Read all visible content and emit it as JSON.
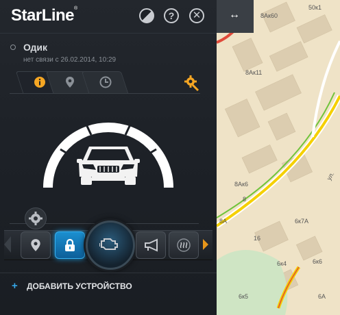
{
  "app": {
    "logo": "StarLine",
    "logo_mark": "®"
  },
  "toolbar": {
    "help_glyph": "?",
    "close_glyph": "✕"
  },
  "device": {
    "name": "Одик",
    "status": "нет связи с 26.02.2014, 10:29"
  },
  "tabs": [
    {
      "icon": "info-icon",
      "active": true
    },
    {
      "icon": "location-pin-icon",
      "active": false
    },
    {
      "icon": "clock-icon",
      "active": false
    }
  ],
  "controls": [
    {
      "icon": "location-pin-icon"
    },
    {
      "icon": "lock-icon",
      "active": true
    },
    {
      "icon": "engine-icon",
      "main": true
    },
    {
      "icon": "horn-icon"
    },
    {
      "icon": "heater-icon"
    }
  ],
  "add_device": {
    "plus": "+",
    "label": "ДОБАВИТЬ УСТРОЙСТВО"
  },
  "map": {
    "handle_glyph": "↔",
    "labels": [
      "8Ак60",
      "50к1",
      "8Ак11",
      "8Ак6",
      "8",
      "8А",
      "6к7А",
      "16",
      "6к4",
      "6к6",
      "6к5",
      "6А",
      "ул."
    ],
    "roads": {
      "main": "#f5d000",
      "side": "#6fc33a",
      "alert": "#e04a3a"
    }
  },
  "colors": {
    "accent": "#36a7e8",
    "highlight": "#f5a623",
    "panel": "#1d2127"
  }
}
